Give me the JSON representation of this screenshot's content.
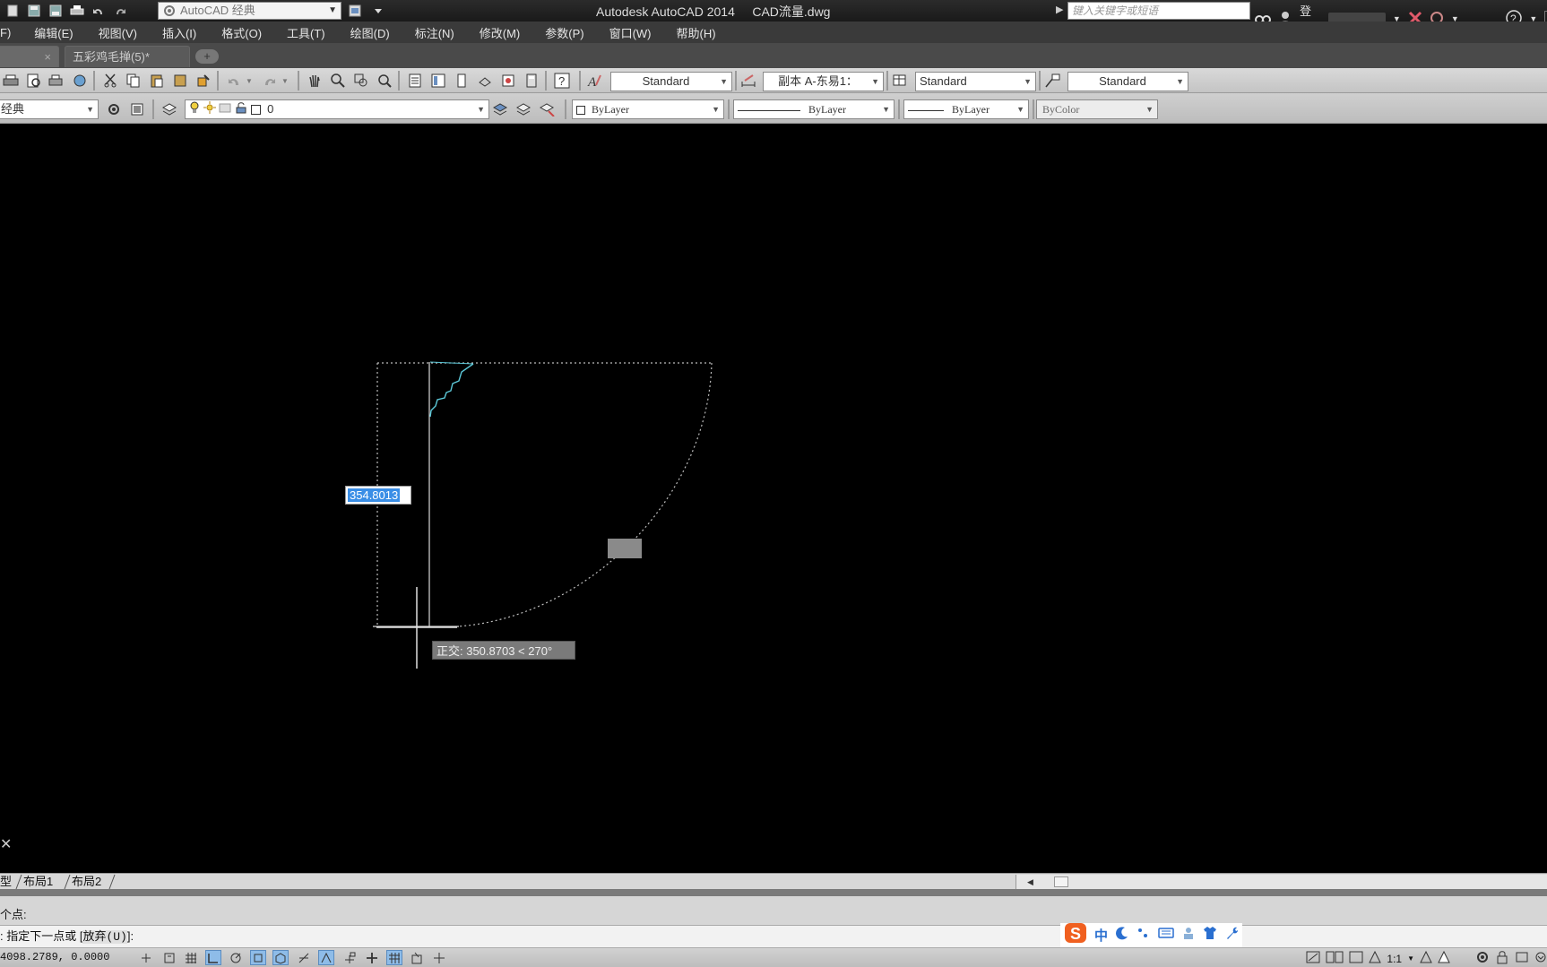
{
  "titlebar": {
    "workspace": "AutoCAD 经典",
    "app_title": "Autodesk AutoCAD 2014     CAD流量.dwg",
    "search_placeholder": "键入关键字或短语",
    "login_label": "登录"
  },
  "menu": {
    "items": [
      "F)",
      "编辑(E)",
      "视图(V)",
      "插入(I)",
      "格式(O)",
      "工具(T)",
      "绘图(D)",
      "标注(N)",
      "修改(M)",
      "参数(P)",
      "窗口(W)",
      "帮助(H)"
    ]
  },
  "tabs": {
    "close_glyph": "×",
    "doc_tab": "五彩鸡毛掸(5)*",
    "add_glyph": "+"
  },
  "styles": {
    "text_style": "Standard",
    "dim_style": "副本 A-东易1：",
    "table_style": "Standard",
    "multileader_style": "Standard"
  },
  "layers": {
    "workspace_partial": "经典",
    "current_layer": "0",
    "color": "ByLayer",
    "linetype": "ByLayer",
    "lineweight": "ByLayer",
    "plotstyle": "ByColor"
  },
  "drawing": {
    "dynamic_input_value": "354.8013",
    "tooltip": "正交: 350.8703 < 270°",
    "ucs_glyph": "✕"
  },
  "layout_tabs": [
    "型",
    "布局1",
    "布局2"
  ],
  "command": {
    "history_line": "个点:",
    "prompt_prefix": ": 指定下一点或 [",
    "prompt_option": "放弃(U)",
    "prompt_suffix": "]:"
  },
  "ime": {
    "logo_letter": "S",
    "mode": "中"
  },
  "status": {
    "coordinates": "4098.2789, 0.0000",
    "annotation_scale": "1:1"
  }
}
